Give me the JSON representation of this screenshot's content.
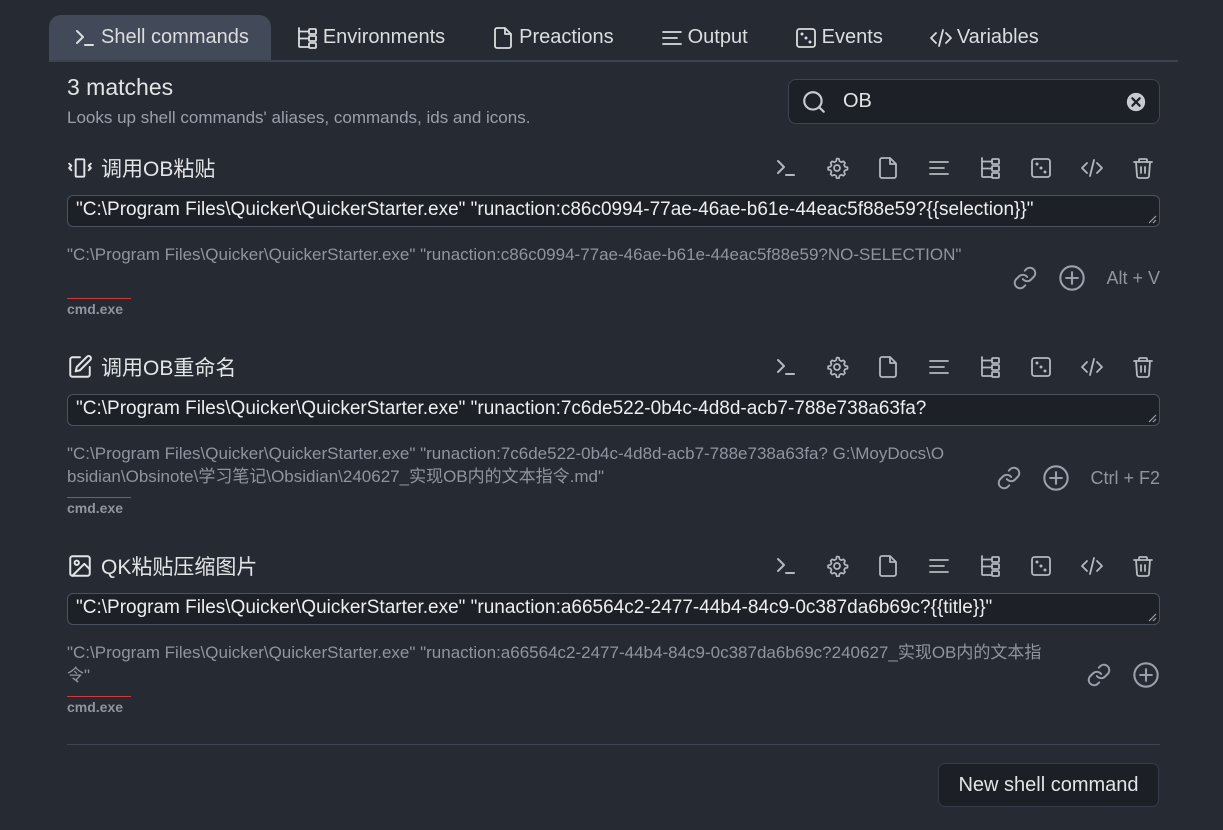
{
  "tabs": [
    {
      "label": "Shell commands",
      "icon": "terminal-icon",
      "active": true
    },
    {
      "label": "Environments",
      "icon": "tree-icon"
    },
    {
      "label": "Preactions",
      "icon": "file-icon"
    },
    {
      "label": "Output",
      "icon": "lines-icon"
    },
    {
      "label": "Events",
      "icon": "dice-icon"
    },
    {
      "label": "Variables",
      "icon": "code-icon"
    }
  ],
  "search": {
    "matches": "3 matches",
    "description": "Looks up shell commands' aliases, commands, ids and icons.",
    "value": "OB"
  },
  "commands": [
    {
      "title": "调用OB粘贴",
      "icon": "vibrate-icon",
      "command": "\"C:\\Program Files\\Quicker\\QuickerStarter.exe\" \"runaction:c86c0994-77ae-46ae-b61e-44eac5f88e59?{{selection}}\"",
      "preview": "\"C:\\Program Files\\Quicker\\QuickerStarter.exe\" \"runaction:c86c0994-77ae-46ae-b61e-44eac5f88e59?NO-SELECTION\"",
      "shell": "cmd.exe",
      "hotkey": "Alt + V"
    },
    {
      "title": "调用OB重命名",
      "icon": "edit-icon",
      "command": "\"C:\\Program Files\\Quicker\\QuickerStarter.exe\" \"runaction:7c6de522-0b4c-4d8d-acb7-788e738a63fa?",
      "preview": "\"C:\\Program Files\\Quicker\\QuickerStarter.exe\" \"runaction:7c6de522-0b4c-4d8d-acb7-788e738a63fa? G:\\MoyDocs\\Obsidian\\Obsinote\\学习笔记\\Obsidian\\240627_实现OB内的文本指令.md\"",
      "shell": "cmd.exe",
      "hotkey": "Ctrl + F2"
    },
    {
      "title": "QK粘贴压缩图片",
      "icon": "image-icon",
      "command": "\"C:\\Program Files\\Quicker\\QuickerStarter.exe\" \"runaction:a66564c2-2477-44b4-84c9-0c387da6b69c?{{title}}\"",
      "preview": "\"C:\\Program Files\\Quicker\\QuickerStarter.exe\" \"runaction:a66564c2-2477-44b4-84c9-0c387da6b69c?240627_实现OB内的文本指令\"",
      "shell": "cmd.exe",
      "hotkey": ""
    }
  ],
  "new_button": "New shell command"
}
